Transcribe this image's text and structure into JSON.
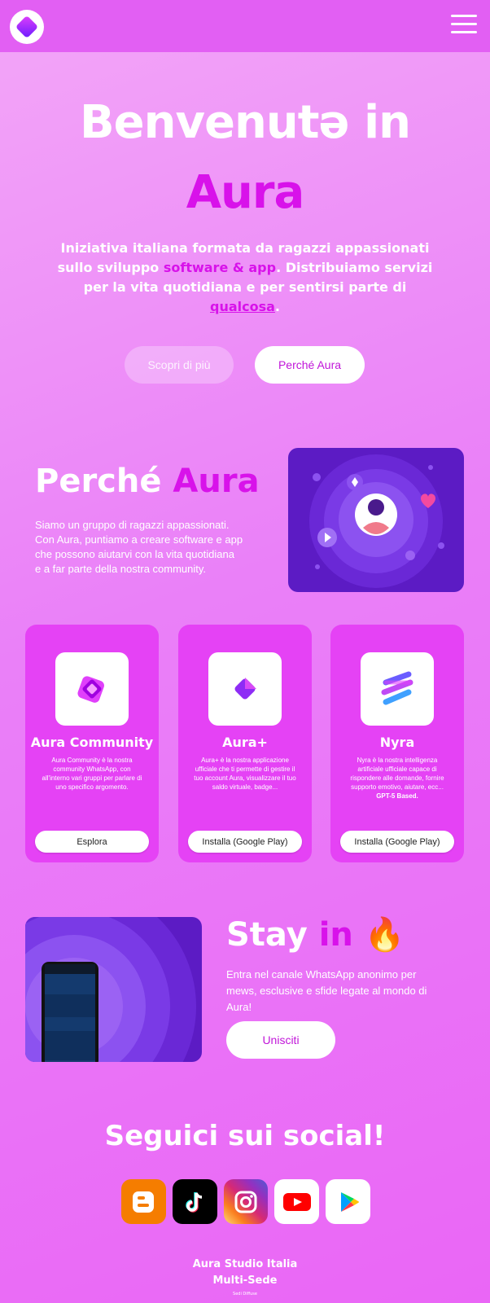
{
  "colors": {
    "accent": "#d812ea",
    "navbar": "#e25ff3",
    "card": "#e542f5",
    "art_bg": "#5c1bc4"
  },
  "navbar": {
    "logo_icon": "aura-logo-icon",
    "menu_icon": "hamburger-menu-icon"
  },
  "hero": {
    "title_line1": "Benvenutə in",
    "title_line2": "Aura",
    "desc_part1": "Iniziativa italiana formata da ragazzi appassionati sullo sviluppo ",
    "desc_highlight": "software & app",
    "desc_part2": ". Distribuiamo servizi per la vita quotidiana e per sentirsi parte di ",
    "desc_link": "qualcosa",
    "desc_end": ".",
    "btn_discover": "Scopri di più",
    "btn_why": "Perché Aura"
  },
  "why": {
    "title_plain": "Perché ",
    "title_accent": "Aura",
    "text_lines": [
      "Siamo un gruppo di ragazzi appassionati.",
      "Con Aura, puntiamo a creare software e app",
      "che possono aiutarvi con la vita quotidiana",
      "e a far parte della nostra community."
    ]
  },
  "cards": [
    {
      "icon": "aura-community-icon",
      "title": "Aura Community",
      "desc": "Aura Community è la nostra community WhatsApp, con all'interno vari gruppi per parlare di uno specifico argomento.",
      "extra": "",
      "button": "Esplora"
    },
    {
      "icon": "aura-plus-icon",
      "title": "Aura+",
      "desc": "Aura+ è la nostra applicazione ufficiale che ti permette di gestire il tuo account Aura, visualizzare il tuo saldo virtuale, badge...",
      "extra": "",
      "button": "Installa (Google Play)"
    },
    {
      "icon": "nyra-icon",
      "title": "Nyra",
      "desc": "Nyra è la nostra intelligenza artificiale ufficiale capace di rispondere alle domande, fornire supporto emotivo, aiutare, ecc...",
      "extra": "GPT-5 Based.",
      "button": "Installa (Google Play)"
    }
  ],
  "stay": {
    "title_plain": "Stay ",
    "title_accent": "in",
    "title_emoji": "🔥",
    "text": "Entra nel canale WhatsApp anonimo per mews, esclusive e sfide legate al mondo di Aura!",
    "button": "Unisciti"
  },
  "social": {
    "title": "Seguici sui social!",
    "icons": [
      "blogger-icon",
      "tiktok-icon",
      "instagram-icon",
      "youtube-icon",
      "google-play-icon"
    ]
  },
  "footer": {
    "name": "Aura Studio Italia",
    "sub": "Multi-Sede",
    "tiny": "Sedi Diffuse"
  }
}
